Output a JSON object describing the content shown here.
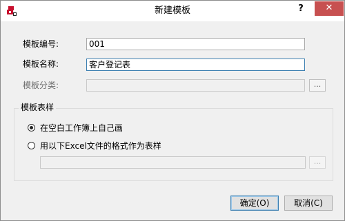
{
  "window": {
    "title": "新建模板",
    "help_label": "?",
    "close_label": "✕"
  },
  "fields": {
    "number_label": "模板编号:",
    "number_value": "001",
    "name_label": "模板名称:",
    "name_value": "客户登记表",
    "category_label": "模板分类:",
    "category_value": "",
    "browse_label": "..."
  },
  "template_style": {
    "group_title": "模板表样",
    "option_blank": "在空白工作簿上自己画",
    "option_excel": "用以下Excel文件的格式作为表样",
    "selected": "option_blank",
    "excel_path": "",
    "browse_label": "..."
  },
  "buttons": {
    "ok": "确定(O)",
    "cancel": "取消(C)"
  },
  "colors": {
    "close_button": "#c75050",
    "dialog_bg": "#f0f0f0",
    "focus_border": "#3c7fb1"
  }
}
